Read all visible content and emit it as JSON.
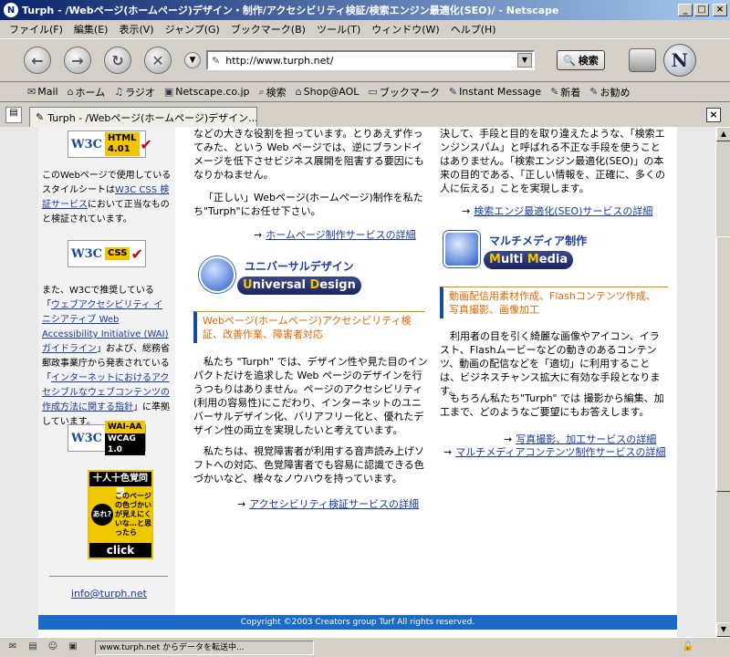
{
  "window": {
    "title": "Turph - /Webページ(ホームページ)デザイン・制作/アクセシビリティ検証/検索エンジン最適化(SEO)/ - Netscape",
    "minimize": "_",
    "maximize": "□",
    "close": "×"
  },
  "menu": [
    "ファイル(F)",
    "編集(E)",
    "表示(V)",
    "ジャンプ(G)",
    "ブックマーク(B)",
    "ツール(T)",
    "ウィンドウ(W)",
    "ヘルプ(H)"
  ],
  "nav": {
    "url": "http://www.turph.net/",
    "search_label": "検索",
    "logo": "N"
  },
  "personal_toolbar": [
    "Mail",
    "ホーム",
    "ラジオ",
    "Netscape.co.jp",
    "検索",
    "Shop@AOL",
    "ブックマーク",
    "Instant Message",
    "新着",
    "お勧め"
  ],
  "tab": {
    "label": "Turph - /Webページ(ホームページ)デザイン..."
  },
  "left": {
    "html_badge": "HTML 4.01",
    "html_text": "このWebページで使用しているスタイルシートは",
    "css_link": "W3C CSS 検証サービス",
    "css_text_after": "において正当なものと検証されています。",
    "css_badge": "CSS",
    "wai_text1": "また、W3Cで推奨している「",
    "wai_link1": "ウェブアクセシビリティ イニシアティブ Web Accessibility Initiative (WAI)ガイドライン",
    "wai_text2": "」および、総務省郵政事業庁から発表されている「",
    "wai_link2": "インターネットにおけるアクセシブルなウェブコンテンツの作成方法に関する指針",
    "wai_text3": "」に準拠しています。",
    "wai_badge_top": "WAI-AA",
    "wai_badge_bottom": "WCAG 1.0",
    "w3c": "W3C",
    "yb_head": "十人十色覚同盟",
    "yb_circle": "あれ?",
    "yb_text": "このページの色づかいが見えにくいな…と思ったら",
    "yb_click": "click",
    "email": "info@turph.net"
  },
  "col1": {
    "intro": "などの大きな役割を担っています。とりあえず作ってみた、という Web ページでは、逆にブランドイメージを低下させビジネス展開を阻害する要因にもなりかねません。",
    "trust": "「正しい」Webページ(ホームページ)制作を私たち\"Turph\"にお任せ下さい。",
    "link_home": "ホームページ制作サービスの詳細",
    "ud_jp": "ユニバーサルデザイン",
    "ud_en_u": "U",
    "ud_en_rest1": "niversal ",
    "ud_en_d": "D",
    "ud_en_rest2": "esign",
    "ud_sub": "Webページ(ホームページ)アクセシビリティ検証、改善作業、障害者対応",
    "p1": "私たち \"Turph\" では、デザイン性や見た目のインパクトだけを追求した Web ページのデザインを行うつもりはありません。ページのアクセシビリティ(利用の容易性)にこだわり、インターネットのユニバーサルデザイン化、バリアフリー化と、優れたデザイン性の両立を実現したいと考えています。",
    "p2": "私たちは、視覚障害者が利用する音声読み上げソフトへの対応、色覚障害者でも容易に認識できる色づかいなど、様々なノウハウを持っています。",
    "link_access": "アクセシビリティ検証サービスの詳細"
  },
  "col2": {
    "intro": "決して、手段と目的を取り違えたような、「検索エンジンスパム」と呼ばれる不正な手段を使うことはありません。「検索エンジン最適化(SEO)」の本来の目的である、「正しい情報を、正確に、多くの人に伝える」ことを実現します。",
    "link_seo": "検索エンジ最適化(SEO)サービスの詳細",
    "mm_jp": "マルチメディア制作",
    "mm_en_m1": "M",
    "mm_en_rest1": "ulti ",
    "mm_en_m2": "M",
    "mm_en_rest2": "edia",
    "mm_sub": "動画配信用素材作成、Flashコンテンツ作成、写真撮影、画像加工",
    "p1": "利用者の目を引く綺麗な画像やアイコン、イラスト、Flashムービーなどの動きのあるコンテンツ、動画の配信などを「適切」に利用することは、ビジネスチャンス拡大に有効な手段となります。",
    "p2": "もちろん私たち\"Turph\" では 撮影から編集、加工まで、どのようなご要望にもお答えします。",
    "link_photo": "写真撮影、加工サービスの詳細",
    "link_mm": "マルチメディアコンテンツ制作サービスの詳細"
  },
  "arrow": "→",
  "footer": "Copyright ©2003 Creators group Turf All rights reserved.",
  "status": {
    "text": "www.turph.net からデータを転送中..."
  }
}
